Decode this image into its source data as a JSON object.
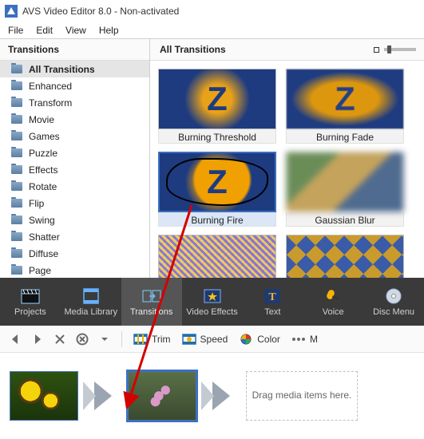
{
  "window": {
    "title": "AVS Video Editor 8.0 - Non-activated"
  },
  "menu": {
    "file": "File",
    "edit": "Edit",
    "view": "View",
    "help": "Help"
  },
  "sidebar": {
    "header": "Transitions",
    "items": [
      {
        "label": "All Transitions",
        "selected": true
      },
      {
        "label": "Enhanced"
      },
      {
        "label": "Transform"
      },
      {
        "label": "Movie"
      },
      {
        "label": "Games"
      },
      {
        "label": "Puzzle"
      },
      {
        "label": "Effects"
      },
      {
        "label": "Rotate"
      },
      {
        "label": "Flip"
      },
      {
        "label": "Swing"
      },
      {
        "label": "Shatter"
      },
      {
        "label": "Diffuse"
      },
      {
        "label": "Page"
      }
    ]
  },
  "gallery": {
    "header": "All Transitions",
    "items": [
      {
        "label": "Burning Threshold",
        "art": "t-burnthresh"
      },
      {
        "label": "Burning Fade",
        "art": "t-burnfade"
      },
      {
        "label": "Burning Fire",
        "art": "t-burnfire",
        "selected": true
      },
      {
        "label": "Gaussian Blur",
        "art": "t-gaussian"
      },
      {
        "label": "",
        "art": "t-noise1",
        "partial": true
      },
      {
        "label": "",
        "art": "t-mosaic",
        "partial": true
      }
    ]
  },
  "modules": {
    "items": [
      {
        "label": "Projects",
        "icon": "clapper"
      },
      {
        "label": "Media Library",
        "icon": "film"
      },
      {
        "label": "Transitions",
        "icon": "transition",
        "active": true
      },
      {
        "label": "Video Effects",
        "icon": "fx"
      },
      {
        "label": "Text",
        "icon": "T"
      },
      {
        "label": "Voice",
        "icon": "mic"
      },
      {
        "label": "Disc Menu",
        "icon": "disc"
      }
    ]
  },
  "editbar": {
    "trim": "Trim",
    "speed": "Speed",
    "color": "Color",
    "more": "M"
  },
  "storyboard": {
    "drop_hint": "Drag media items here."
  }
}
